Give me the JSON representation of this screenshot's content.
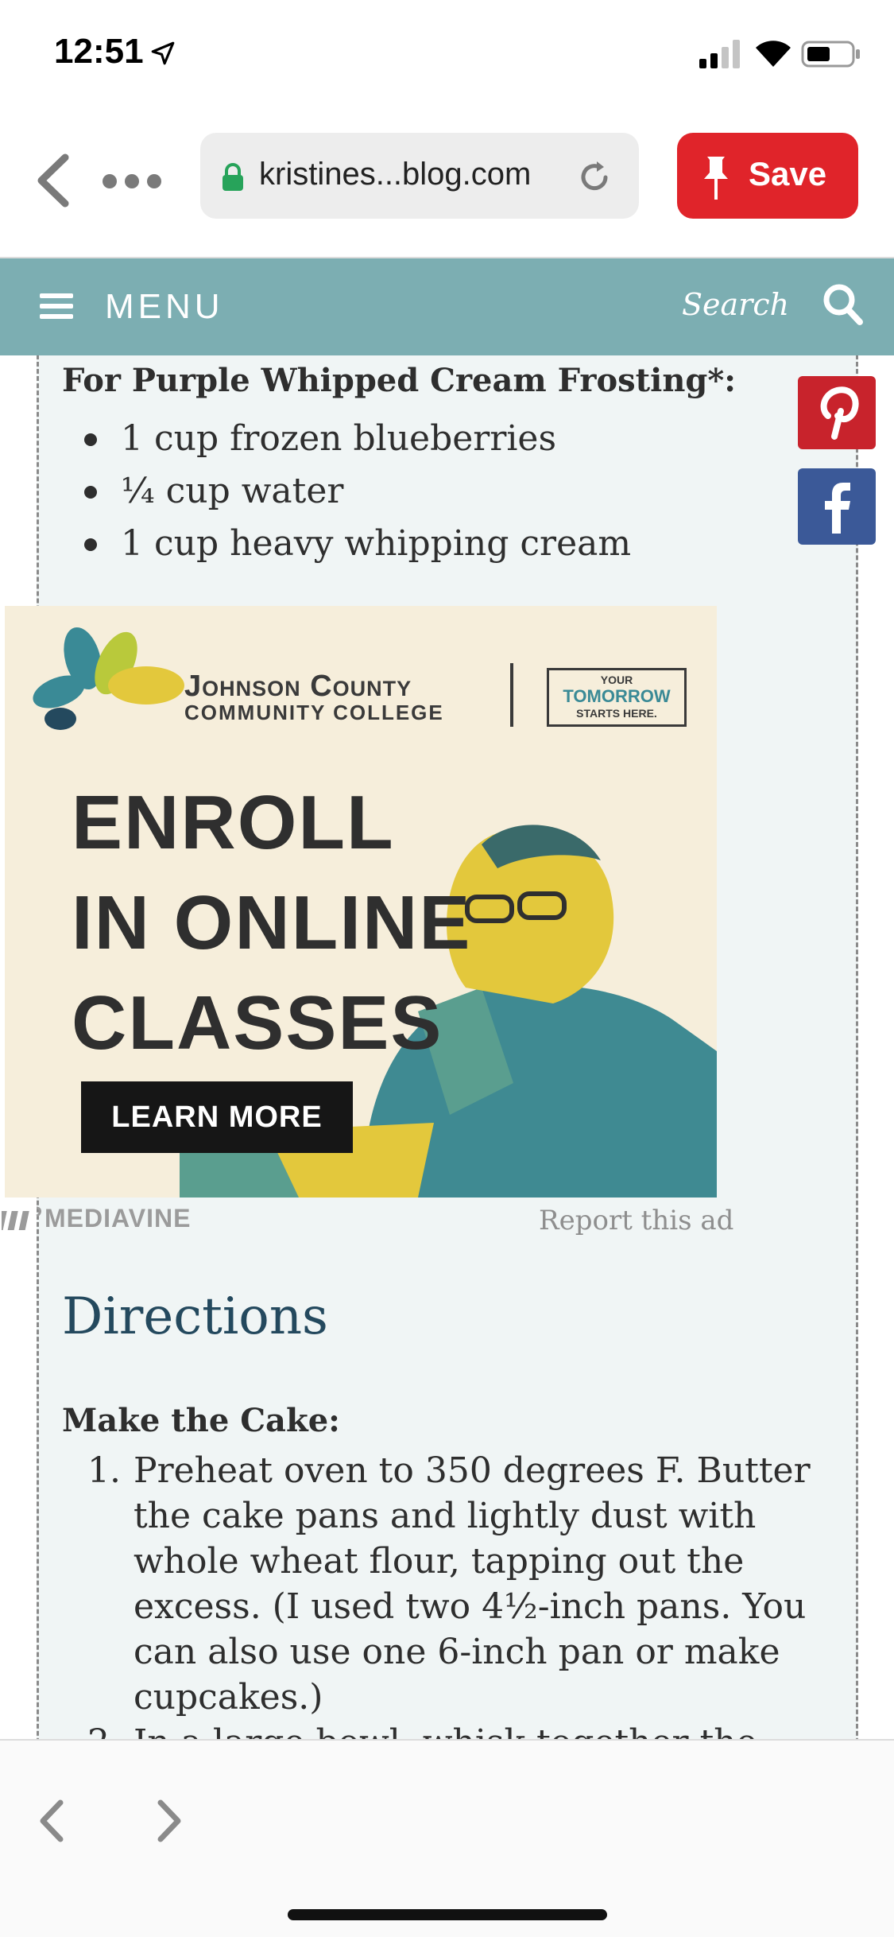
{
  "status_bar": {
    "time": "12:51"
  },
  "browser": {
    "url": "kristines...blog.com",
    "save_label": "Save"
  },
  "site_nav": {
    "menu_label": "MENU",
    "search_label": "Search"
  },
  "ingredients": {
    "heading": "For Purple Whipped Cream Frosting*:",
    "items": [
      "1 cup frozen blueberries",
      "¼ cup water",
      "1 cup heavy whipping cream"
    ]
  },
  "share": {
    "pinterest_icon": "pinterest-icon",
    "facebook_icon": "facebook-icon"
  },
  "ad": {
    "college_line1": "Johnson County",
    "college_line2": "COMMUNITY COLLEGE",
    "tagline_top": "YOUR",
    "tagline_middle": "TOMORROW",
    "tagline_bottom": "STARTS HERE.",
    "headline_1": "ENROLL",
    "headline_2": "IN ONLINE",
    "headline_3": "CLASSES",
    "cta": "LEARN MORE",
    "network": "MEDIAVINE",
    "report_label": "Report this ad"
  },
  "directions": {
    "heading": "Directions",
    "subheading": "Make the Cake:",
    "steps": [
      {
        "number": "1.",
        "text": "Preheat oven to 350 degrees F. Butter the cake pans and lightly dust with whole wheat flour, tapping out the excess. (I used two 4½-inch pans. You can also use one 6-inch pan or make cupcakes.)"
      },
      {
        "number": "2.",
        "text": "In a large bowl, whisk together the whole wheat flour, baking powder, baking soda,"
      }
    ]
  },
  "colors": {
    "nav_bg": "#7caeb2",
    "save_red": "#e0242a",
    "pinterest_red": "#c8232c",
    "facebook_blue": "#3b5998",
    "heading_blue": "#24495e",
    "card_bg": "#f0f5f5"
  }
}
